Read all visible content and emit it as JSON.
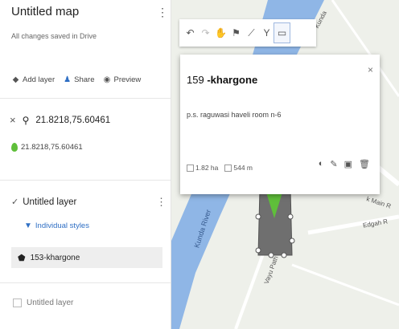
{
  "sidebar": {
    "map_title": "Untitled map",
    "saved_status": "All changes saved in Drive",
    "actions": {
      "add_layer": "Add layer",
      "share": "Share",
      "preview": "Preview"
    },
    "search": {
      "query": "21.8218,75.60461",
      "result": "21.8218,75.60461"
    },
    "layer": {
      "name": "Untitled layer",
      "styles_link": "Individual styles",
      "feature": "153-khargone"
    },
    "layer2": {
      "name": "Untitled layer"
    }
  },
  "map": {
    "popup": {
      "number": "159",
      "title": "-khargone",
      "description": "p.s. raguwasi haveli room n-6",
      "area": "1.82 ha",
      "perimeter": "544 m"
    },
    "labels": {
      "river": "Kunda River",
      "river_top": "Kunda",
      "road1": "k Main R",
      "road2": "Edgah R",
      "road3": "Vayu Path"
    },
    "colors": {
      "water": "#8fb6e6",
      "land": "#eef0ea",
      "polygon": "#6f6f6f",
      "pin": "#5fbf3a"
    }
  }
}
